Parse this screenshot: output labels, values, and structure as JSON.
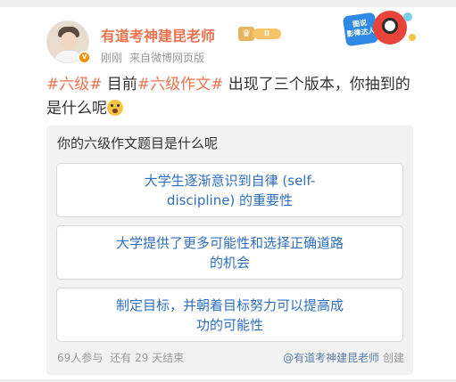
{
  "header": {
    "username": "有道考神建昆老师",
    "vip_level": "II",
    "verify_mark": "v",
    "time": "刚刚",
    "source": "来自微博网页版",
    "mascot_text": "图说\n影律达人"
  },
  "post": {
    "topic1": "#六级#",
    "text1": " 目前",
    "topic2": "#六级作文#",
    "text2": " 出现了三个版本，你抽到的是什么呢",
    "emoji": "scared-face-emoji"
  },
  "poll": {
    "title": "你的六级作文题目是什么呢",
    "options": [
      {
        "label": "大学生逐渐意识到自律 (self-discipline) 的重要性"
      },
      {
        "label": "大学提供了更多可能性和选择正确道路的机会"
      },
      {
        "label": "制定目标，并朝着目标努力可以提高成功的可能性"
      }
    ],
    "participants": "69人参与",
    "remaining": "还有 29 天结束",
    "creator": "@有道考神建昆老师",
    "created_label": "创建"
  },
  "colors": {
    "accent": "#eb7350",
    "link": "#2f6fbf",
    "meta": "#999999",
    "card_bg": "#f2f2f2"
  }
}
